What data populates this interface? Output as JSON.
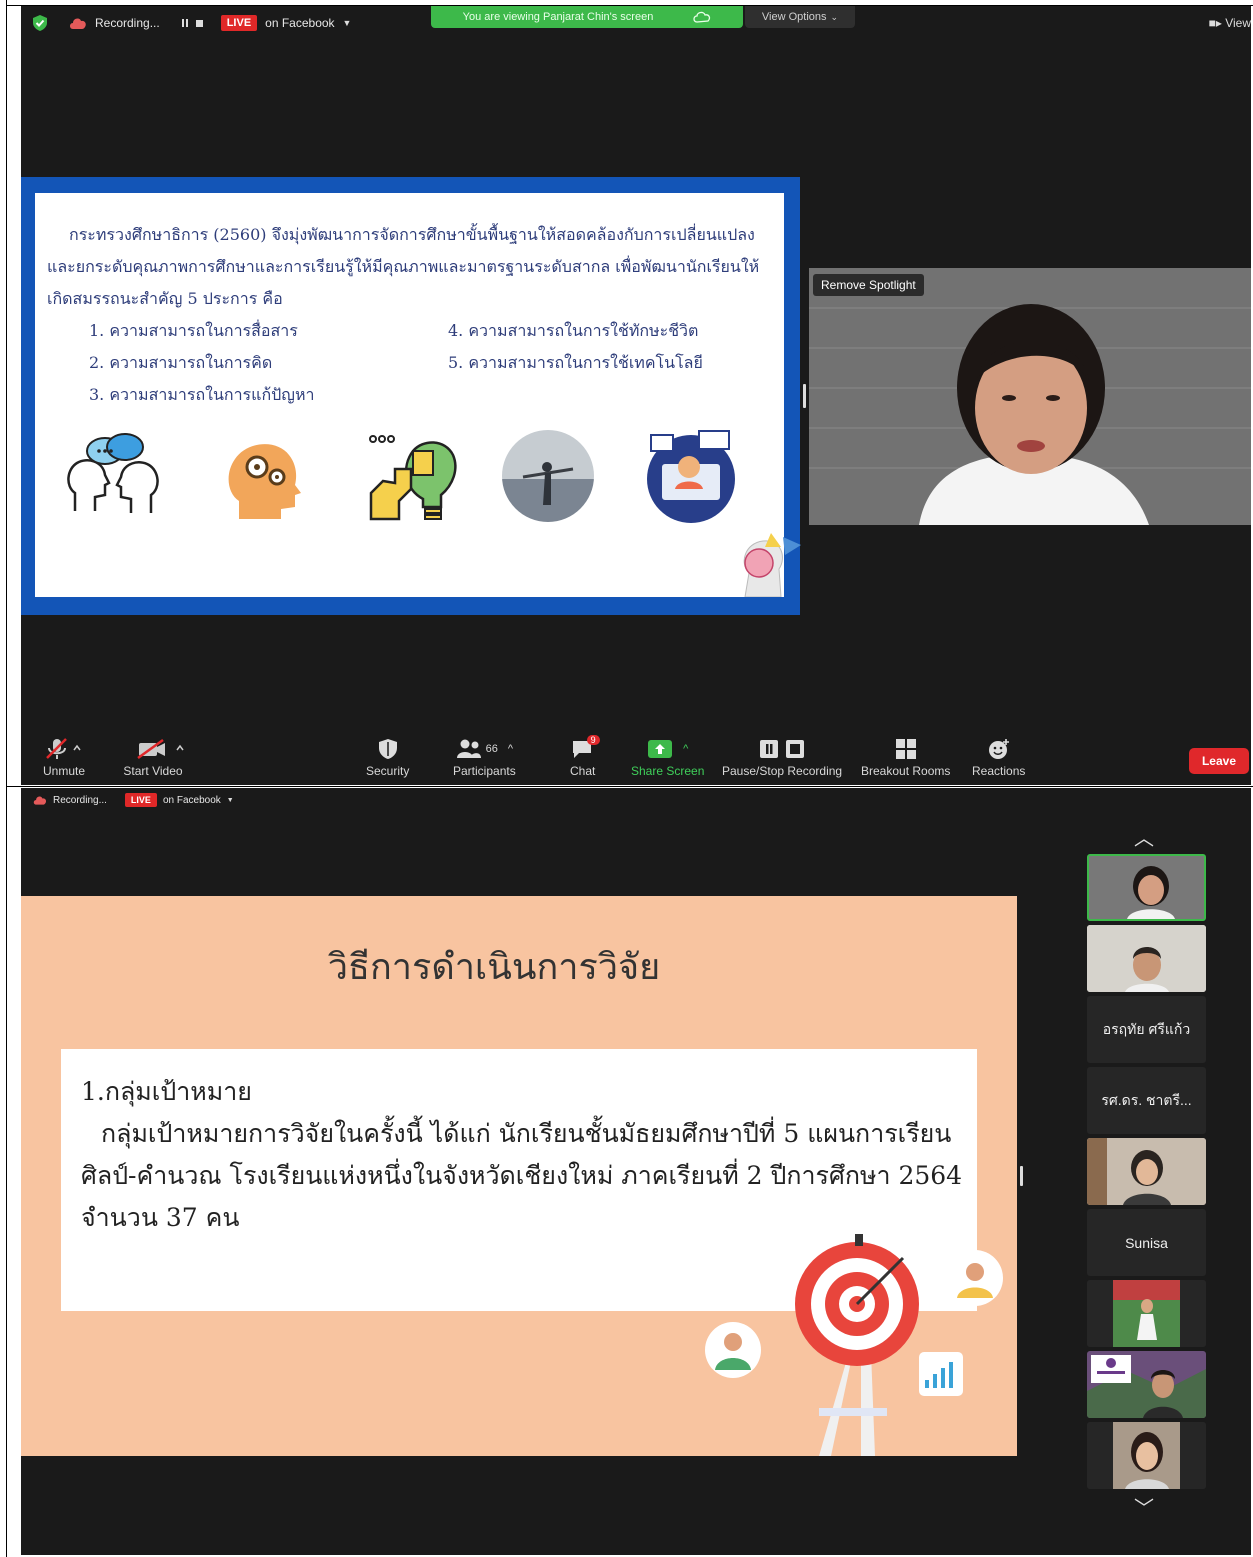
{
  "top": {
    "recording_label": "Recording...",
    "live_label": "LIVE",
    "facebook_label": "on Facebook",
    "viewing_banner": "You are viewing Panjarat Chin's screen",
    "view_options_label": "View Options",
    "view_right_label": "View",
    "remove_spotlight_label": "Remove Spotlight",
    "slide": {
      "line1": "กระทรวงศึกษาธิการ (2560) จึงมุ่งพัฒนาการจัดการศึกษาขั้นพื้นฐานให้สอดคล้องกับการเปลี่ยนแปลง",
      "line2": "และยกระดับคุณภาพการศึกษาและการเรียนรู้ให้มีคุณภาพและมาตรฐานระดับสากล เพื่อพัฒนานักเรียนให้",
      "line3": "เกิดสมรรถนะสำคัญ 5 ประการ คือ",
      "items": [
        "1. ความสามารถในการสื่อสาร",
        "2. ความสามารถในการคิด",
        "3. ความสามารถในการแก้ปัญหา",
        "4. ความสามารถในการใช้ทักษะชีวิต",
        "5. ความสามารถในการใช้เทคโนโลยี"
      ]
    },
    "toolbar": {
      "unmute": "Unmute",
      "start_video": "Start Video",
      "security": "Security",
      "participants": "Participants",
      "participants_count": "66",
      "chat": "Chat",
      "chat_badge": "9",
      "share_screen": "Share Screen",
      "pause_stop": "Pause/Stop Recording",
      "breakout": "Breakout Rooms",
      "reactions": "Reactions",
      "leave": "Leave"
    },
    "colors": {
      "live": "#e02828",
      "share_green": "#3db94a",
      "slide_blue": "#1355b7",
      "leave": "#e0282b"
    }
  },
  "bottom": {
    "recording_label": "Recording...",
    "live_label": "LIVE",
    "facebook_label": "on Facebook",
    "slide": {
      "title": "วิธีการดำเนินการวิจัย",
      "heading": "1.กลุ่มเป้าหมาย",
      "line1": "กลุ่มเป้าหมายการวิจัยในครั้งนี้ ได้แก่ นักเรียนชั้นมัธยมศึกษาปีที่ 5 แผนการเรียน",
      "line2": "ศิลป์-คำนวณ โรงเรียนแห่งหนึ่งในจังหวัดเชียงใหม่ ภาคเรียนที่ 2 ปีการศึกษา 2564",
      "line3": "จำนวน 37 คน"
    },
    "thumbnails": [
      "อรฤทัย ศรีแก้ว",
      "รศ.ดร. ชาตรี...",
      "Sunisa"
    ],
    "colors": {
      "slide_peach": "#f8c4a0",
      "active_border": "#3db94a"
    }
  }
}
